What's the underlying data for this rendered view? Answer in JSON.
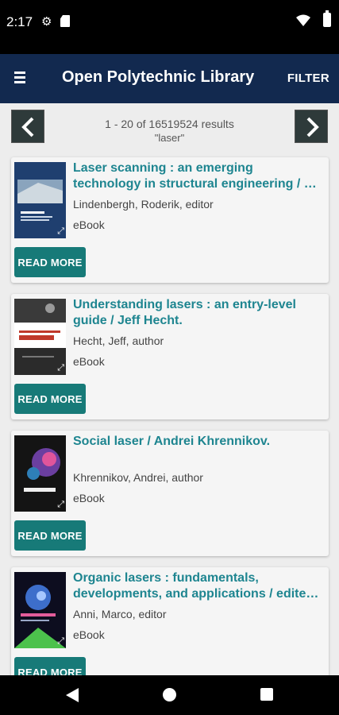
{
  "status_bar": {
    "time": "2:17",
    "icons": [
      "gear-icon",
      "sd-card-icon",
      "wifi-icon",
      "battery-icon"
    ]
  },
  "app_bar": {
    "title": "Open Polytechnic Library",
    "filter_label": "FILTER",
    "menu_icon": "hamburger-menu-icon"
  },
  "pager": {
    "result_count": "1 - 20 of 16519524 results",
    "query": "\"laser\"",
    "prev_icon": "chevron-left-icon",
    "next_icon": "chevron-right-icon"
  },
  "results": [
    {
      "title": "Laser scanning : an emerging technology in structural engineering / …",
      "author": "Lindenbergh, Roderik, editor",
      "format": "eBook",
      "read_more": "READ MORE"
    },
    {
      "title": "Understanding lasers : an entry-level guide / Jeff Hecht.",
      "author": "Hecht, Jeff, author",
      "format": "eBook",
      "read_more": "READ MORE"
    },
    {
      "title": "Social laser / Andrei Khrennikov.",
      "author": "Khrennikov, Andrei, author",
      "format": "eBook",
      "read_more": "READ MORE"
    },
    {
      "title": "Organic lasers : fundamentals, developments, and applications / edite…",
      "author": "Anni, Marco, editor",
      "format": "eBook",
      "read_more": "READ MORE"
    }
  ],
  "colors": {
    "app_bar": "#12294f",
    "title_link": "#1e8590",
    "button": "#177a78",
    "background": "#ededed"
  },
  "nav_bar": {
    "icons": [
      "back-icon",
      "home-icon",
      "recents-icon"
    ]
  }
}
